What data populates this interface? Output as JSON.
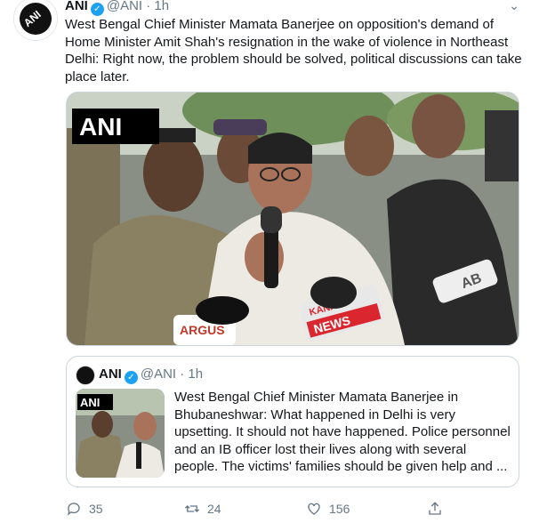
{
  "tweet": {
    "name": "ANI",
    "handle": "@ANI",
    "separator": "·",
    "time": "1h",
    "caret": "⌄",
    "text": "West Bengal Chief Minister Mamata Banerjee on opposition's demand of Home Minister Amit Shah's resignation in the wake of violence in Northeast Delhi: Right now, the problem should be solved, political discussions can take place later.",
    "avatar_text": "ANI",
    "photo": {
      "logo": "ANI",
      "mic_labels": [
        "KANAK",
        "NEWS",
        "ARGUS",
        "AB"
      ]
    }
  },
  "quote": {
    "name": "ANI",
    "handle": "@ANI",
    "separator": "·",
    "time": "1h",
    "thumb_logo": "ANI",
    "text": "West Bengal Chief Minister Mamata Banerjee in Bhubaneshwar: What happened in Delhi is very upsetting. It should not have happened. Police personnel and an IB officer lost their lives along with several people. The victims' families should be given help and ..."
  },
  "actions": {
    "replies": "35",
    "retweets": "24",
    "likes": "156"
  },
  "colors": {
    "text": "#14171a",
    "secondary": "#657786",
    "verified": "#1da1f2",
    "border": "#ccd6dd"
  }
}
